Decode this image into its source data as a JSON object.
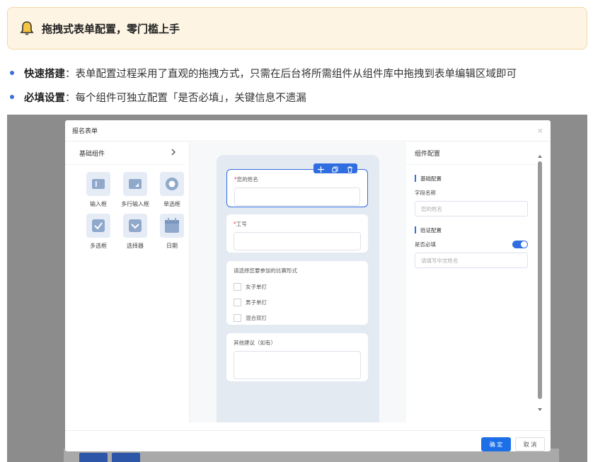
{
  "banner": {
    "icon": "bell-icon",
    "title": "拖拽式表单配置，零门槛上手"
  },
  "bullets": [
    {
      "label": "快速搭建",
      "text": "：表单配置过程采用了直观的拖拽方式，只需在后台将所需组件从组件库中拖拽到表单编辑区域即可"
    },
    {
      "label": "必填设置",
      "text": "：每个组件可独立配置「是否必填」，关键信息不遗漏"
    }
  ],
  "modal": {
    "title": "报名表单",
    "close": "×",
    "left": {
      "header": "基础组件",
      "components": [
        {
          "label": "输入框",
          "icon": "input-icon"
        },
        {
          "label": "多行输入框",
          "icon": "textarea-icon"
        },
        {
          "label": "单选框",
          "icon": "radio-icon"
        },
        {
          "label": "多选框",
          "icon": "checkbox-icon"
        },
        {
          "label": "选择器",
          "icon": "select-icon"
        },
        {
          "label": "日期",
          "icon": "calendar-icon"
        }
      ]
    },
    "form": {
      "name_label": "您的姓名",
      "id_label": "工号",
      "event_label": "请选择您要参加的比赛形式",
      "options": [
        "女子单打",
        "男子单打",
        "混合双打"
      ],
      "suggest_label": "其他建议（如有）"
    },
    "right": {
      "header": "组件配置",
      "basic_section": "基础配置",
      "field_name_label": "字段名称",
      "field_name_value": "您的姓名",
      "validate_section": "验证配置",
      "required_label": "是否必填",
      "required_on": true,
      "placeholder_value": "请填写中文姓名"
    },
    "footer": {
      "ok": "确 定",
      "cancel": "取 消"
    }
  },
  "colors": {
    "accent": "#2f6de1",
    "banner_bg": "#fdf4e3",
    "bullet": "#3a6fe0"
  }
}
